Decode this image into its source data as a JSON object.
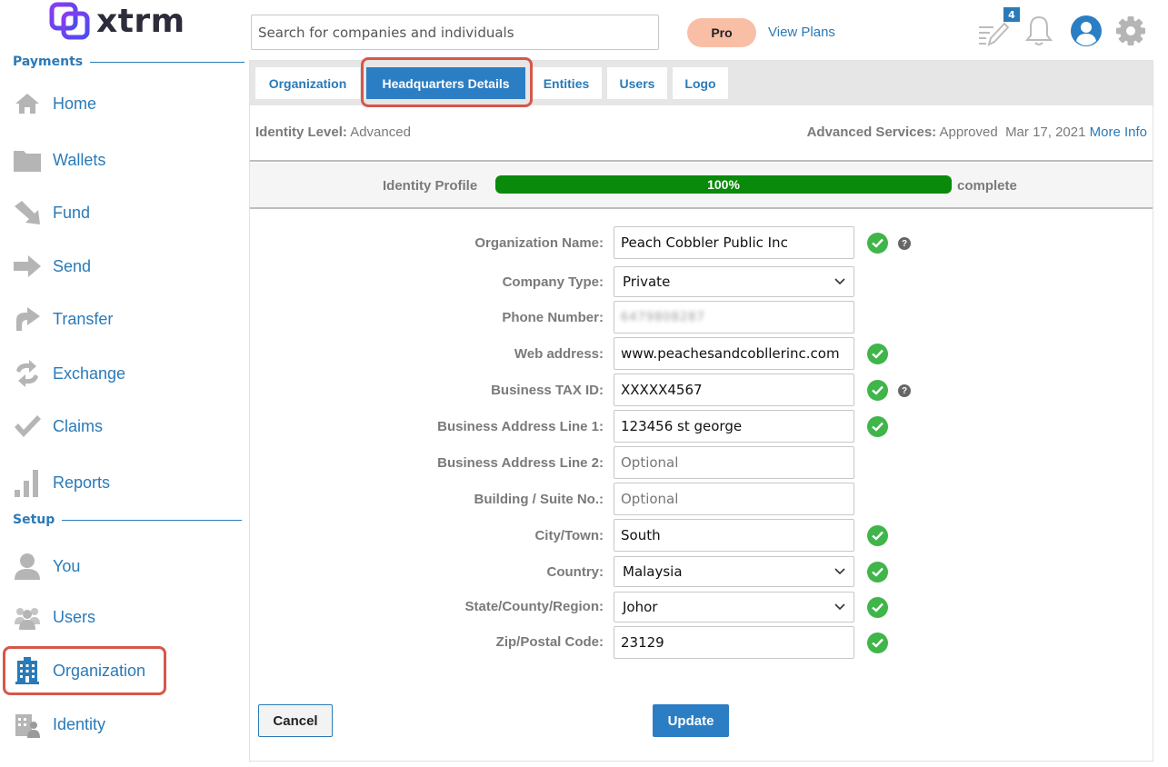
{
  "brand": {
    "name": "xtrm",
    "accent": "#2a7ab8",
    "logo_color": "#6a3cf0"
  },
  "sidebar": {
    "sections": [
      {
        "label": "Payments"
      },
      {
        "label": "Setup"
      }
    ],
    "items": [
      {
        "label": "Home",
        "icon": "home-icon"
      },
      {
        "label": "Wallets",
        "icon": "folder-icon"
      },
      {
        "label": "Fund",
        "icon": "fund-arrow-icon"
      },
      {
        "label": "Send",
        "icon": "send-arrow-icon"
      },
      {
        "label": "Transfer",
        "icon": "transfer-arrow-icon"
      },
      {
        "label": "Exchange",
        "icon": "exchange-icon"
      },
      {
        "label": "Claims",
        "icon": "checkmark-icon"
      },
      {
        "label": "Reports",
        "icon": "bar-chart-icon"
      },
      {
        "label": "You",
        "icon": "person-icon"
      },
      {
        "label": "Users",
        "icon": "users-icon"
      },
      {
        "label": "Organization",
        "icon": "building-icon",
        "selected": true
      },
      {
        "label": "Identity",
        "icon": "identity-icon"
      }
    ]
  },
  "header": {
    "search_placeholder": "Search for companies and individuals",
    "plan_badge": "Pro",
    "view_plans": "View Plans",
    "notes_count": "4",
    "icons": [
      "edit-notes-icon",
      "bell-icon",
      "user-avatar-icon",
      "gear-icon"
    ]
  },
  "tabs": [
    {
      "label": "Organization",
      "active": false
    },
    {
      "label": "Headquarters Details",
      "active": true
    },
    {
      "label": "Entities",
      "active": false
    },
    {
      "label": "Users",
      "active": false
    },
    {
      "label": "Logo",
      "active": false
    }
  ],
  "identity": {
    "level_label": "Identity Level:",
    "level_value": "Advanced",
    "services_label": "Advanced Services:",
    "services_value": "Approved",
    "date": "Mar 17, 2021",
    "more_info": "More Info"
  },
  "profile": {
    "label": "Identity Profile",
    "percent_text": "100%",
    "fraction": 1.0,
    "suffix": "complete",
    "fill_color": "#0a8a0a"
  },
  "form": {
    "org_name": {
      "label": "Organization Name:",
      "value": "Peach Cobbler Public Inc",
      "verified": true,
      "help": "?"
    },
    "company_type": {
      "label": "Company Type:",
      "value": "Private"
    },
    "phone": {
      "label": "Phone Number:",
      "value": "6479808287"
    },
    "web": {
      "label": "Web address:",
      "value": "www.peachesandcobllerinc.com",
      "verified": true
    },
    "tax_id": {
      "label": "Business TAX ID:",
      "value": "XXXXX4567",
      "verified": true,
      "help": "?"
    },
    "addr1": {
      "label": "Business Address Line 1:",
      "value": "123456 st george",
      "verified": true
    },
    "addr2": {
      "label": "Business Address Line 2:",
      "placeholder": "Optional"
    },
    "suite": {
      "label": "Building / Suite No.:",
      "placeholder": "Optional"
    },
    "city": {
      "label": "City/Town:",
      "value": "South",
      "verified": true
    },
    "country": {
      "label": "Country:",
      "value": "Malaysia",
      "verified": true
    },
    "state": {
      "label": "State/County/Region:",
      "value": "Johor",
      "verified": true
    },
    "zip": {
      "label": "Zip/Postal Code:",
      "value": "23129",
      "verified": true
    }
  },
  "buttons": {
    "cancel": "Cancel",
    "update": "Update"
  }
}
